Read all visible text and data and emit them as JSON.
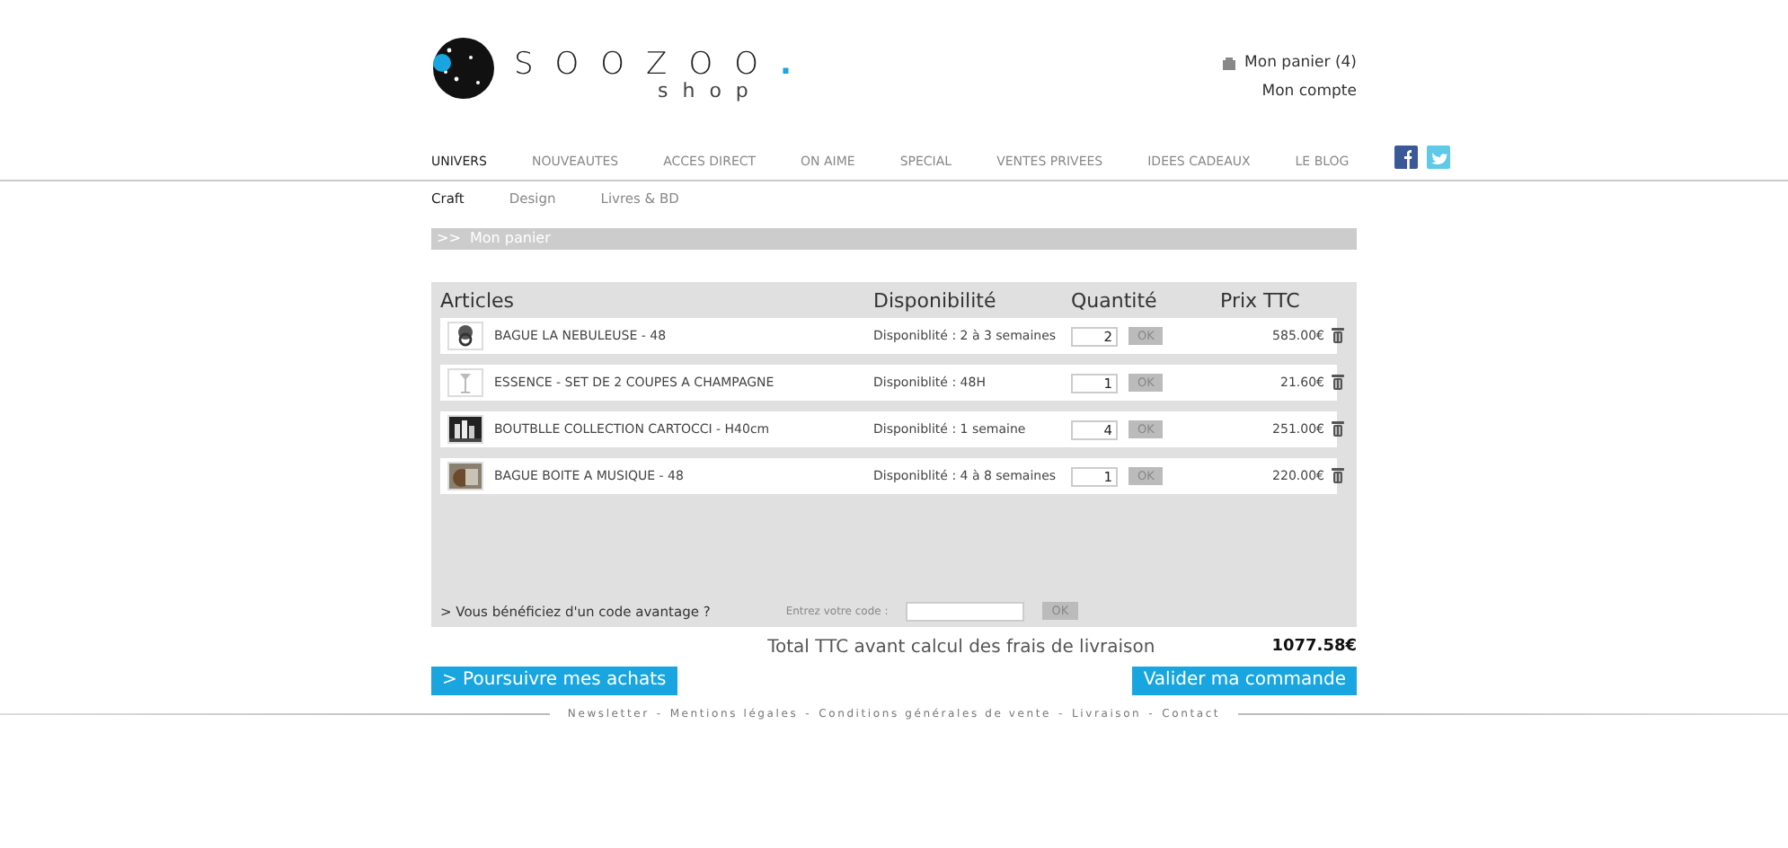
{
  "logo": {
    "name": "SOOZOO",
    "dot": ".",
    "sub": "shop"
  },
  "account": {
    "cart": "Mon panier (4)",
    "account": "Mon compte"
  },
  "nav": [
    {
      "label": "UNIVERS",
      "selected": true
    },
    {
      "label": "NOUVEAUTES",
      "selected": false
    },
    {
      "label": "ACCES DIRECT",
      "selected": false
    },
    {
      "label": "ON AIME",
      "selected": false
    },
    {
      "label": "SPECIAL",
      "selected": false
    },
    {
      "label": "VENTES PRIVEES",
      "selected": false
    },
    {
      "label": "IDEES CADEAUX",
      "selected": false
    },
    {
      "label": "LE BLOG",
      "selected": false
    }
  ],
  "subnav": [
    {
      "label": "Craft",
      "selected": true
    },
    {
      "label": "Design",
      "selected": false
    },
    {
      "label": "Livres & BD",
      "selected": false
    }
  ],
  "breadcrumb": ">>  Mon panier",
  "cart": {
    "columns": [
      "Articles",
      "Disponibilité",
      "Quantité",
      "Prix TTC"
    ],
    "rows": [
      {
        "name": "BAGUE LA NEBULEUSE - 48",
        "availability": "Disponiblité : 2 à 3 semaines",
        "quantity": "2",
        "ok": "OK",
        "price": "585.00€"
      },
      {
        "name": "ESSENCE - SET DE 2 COUPES A CHAMPAGNE",
        "availability": "Disponiblité : 48H",
        "quantity": "1",
        "ok": "OK",
        "price": "21.60€"
      },
      {
        "name": "BOUTBLLE COLLECTION CARTOCCI - H40cm",
        "availability": "Disponiblité : 1 semaine",
        "quantity": "4",
        "ok": "OK",
        "price": "251.00€"
      },
      {
        "name": "BAGUE BOITE A MUSIQUE - 48",
        "availability": "Disponiblité : 4 à 8 semaines",
        "quantity": "1",
        "ok": "OK",
        "price": "220.00€"
      }
    ],
    "promo": {
      "question": ">  Vous bénéficiez d'un code avantage ?",
      "label": "Entrez votre code :",
      "ok": "OK"
    }
  },
  "total": {
    "label": "Total TTC avant calcul des frais de livraison",
    "value": "1077.58€"
  },
  "buttons": {
    "continue": "> Poursuivre mes achats",
    "validate": "Valider ma commande"
  },
  "footer": [
    "Newsletter",
    "-",
    "Mentions légales",
    "-",
    "Conditions générales de vente",
    "-",
    "Livraison",
    "-",
    "Contact"
  ]
}
